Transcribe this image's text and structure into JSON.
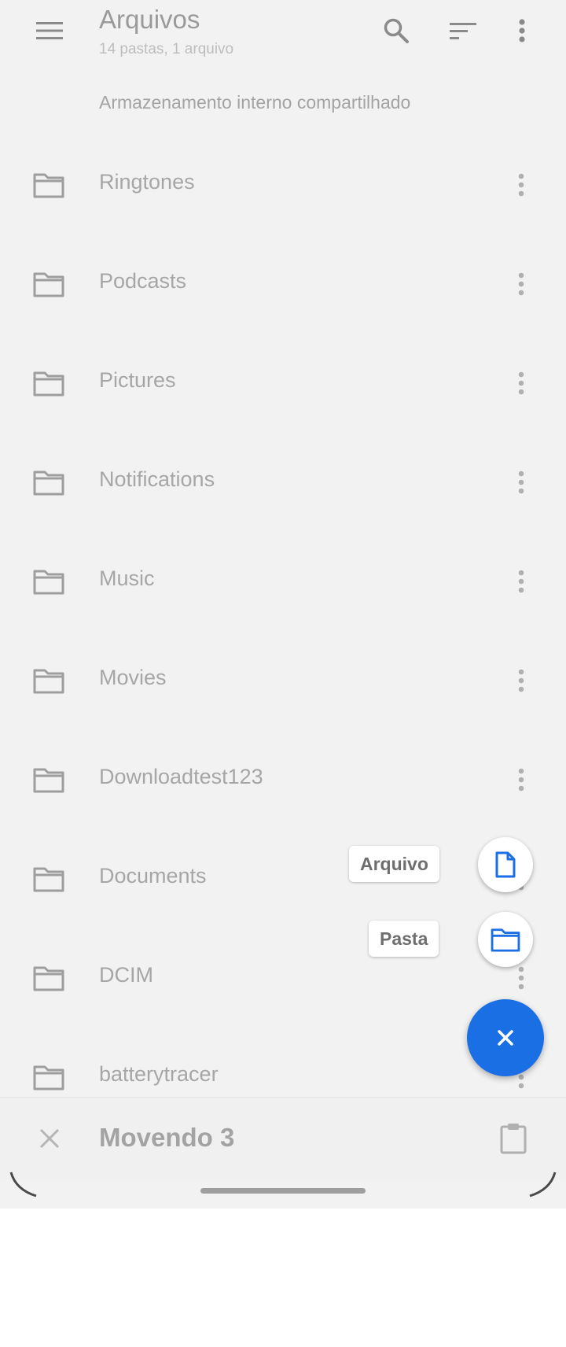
{
  "appbar": {
    "title": "Arquivos",
    "subtitle": "14 pastas, 1 arquivo",
    "icons": [
      "menu-icon",
      "search-icon",
      "sort-icon",
      "more-vert-icon"
    ]
  },
  "breadcrumb": "Armazenamento interno compartilhado",
  "folders": [
    {
      "name": "Ringtones"
    },
    {
      "name": "Podcasts"
    },
    {
      "name": "Pictures"
    },
    {
      "name": "Notifications"
    },
    {
      "name": "Music"
    },
    {
      "name": "Movies"
    },
    {
      "name": "Downloadtest123"
    },
    {
      "name": "Documents"
    },
    {
      "name": "DCIM"
    },
    {
      "name": "batterytracer"
    }
  ],
  "fab_menu": {
    "file_label": "Arquivo",
    "folder_label": "Pasta",
    "accent_color": "#1b6fe5"
  },
  "bottom_bar": {
    "moving_label": "Movendo 3"
  }
}
